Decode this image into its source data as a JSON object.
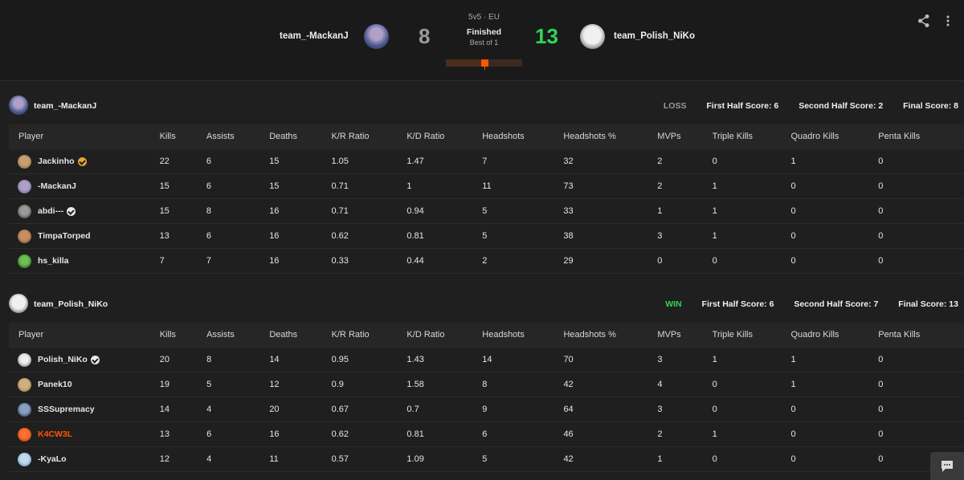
{
  "header": {
    "left_team": "team_-MackanJ",
    "right_team": "team_Polish_NiKo",
    "left_score": "8",
    "right_score": "13",
    "mode": "5v5 · EU",
    "status": "Finished",
    "format": "Best of 1",
    "round_progress": 0.5,
    "colors": {
      "loser_score": "#9a9a9a",
      "winner_score": "#32d35a",
      "accent": "#ff5500"
    },
    "icons": {
      "share": "share-icon",
      "more": "more-vertical-icon"
    }
  },
  "columns": [
    "Player",
    "Kills",
    "Assists",
    "Deaths",
    "K/R Ratio",
    "K/D Ratio",
    "Headshots",
    "Headshots %",
    "MVPs",
    "Triple Kills",
    "Quadro Kills",
    "Penta Kills"
  ],
  "teams": [
    {
      "name": "team_-MackanJ",
      "result": "LOSS",
      "first_half": "First Half Score: 6",
      "second_half": "Second Half Score: 2",
      "final": "Final Score: 8",
      "players": [
        {
          "name": "Jackinho",
          "badge": "gold",
          "stats": [
            "22",
            "6",
            "15",
            "1.05",
            "1.47",
            "7",
            "32",
            "2",
            "0",
            "1",
            "0"
          ]
        },
        {
          "name": "-MackanJ",
          "badge": "",
          "stats": [
            "15",
            "6",
            "15",
            "0.71",
            "1",
            "11",
            "73",
            "2",
            "1",
            "0",
            "0"
          ]
        },
        {
          "name": "abdi---",
          "badge": "white",
          "stats": [
            "15",
            "8",
            "16",
            "0.71",
            "0.94",
            "5",
            "33",
            "1",
            "1",
            "0",
            "0"
          ]
        },
        {
          "name": "TimpaTorped",
          "badge": "",
          "stats": [
            "13",
            "6",
            "16",
            "0.62",
            "0.81",
            "5",
            "38",
            "3",
            "1",
            "0",
            "0"
          ]
        },
        {
          "name": "hs_killa",
          "badge": "",
          "stats": [
            "7",
            "7",
            "16",
            "0.33",
            "0.44",
            "2",
            "29",
            "0",
            "0",
            "0",
            "0"
          ]
        }
      ]
    },
    {
      "name": "team_Polish_NiKo",
      "result": "WIN",
      "first_half": "First Half Score: 6",
      "second_half": "Second Half Score: 7",
      "final": "Final Score: 13",
      "players": [
        {
          "name": "Polish_NiKo",
          "badge": "white",
          "stats": [
            "20",
            "8",
            "14",
            "0.95",
            "1.43",
            "14",
            "70",
            "3",
            "1",
            "1",
            "0"
          ]
        },
        {
          "name": "Panek10",
          "badge": "",
          "stats": [
            "19",
            "5",
            "12",
            "0.9",
            "1.58",
            "8",
            "42",
            "4",
            "0",
            "1",
            "0"
          ]
        },
        {
          "name": "SSSupremacy",
          "badge": "",
          "stats": [
            "14",
            "4",
            "20",
            "0.67",
            "0.7",
            "9",
            "64",
            "3",
            "0",
            "0",
            "0"
          ]
        },
        {
          "name": "K4CW3L",
          "badge": "",
          "highlight": true,
          "stats": [
            "13",
            "6",
            "16",
            "0.62",
            "0.81",
            "6",
            "46",
            "2",
            "1",
            "0",
            "0"
          ]
        },
        {
          "name": "-KyaLo",
          "badge": "",
          "stats": [
            "12",
            "4",
            "11",
            "0.57",
            "1.09",
            "5",
            "42",
            "1",
            "0",
            "0",
            "0"
          ]
        }
      ]
    }
  ],
  "chat": {
    "icon": "chat-icon"
  }
}
